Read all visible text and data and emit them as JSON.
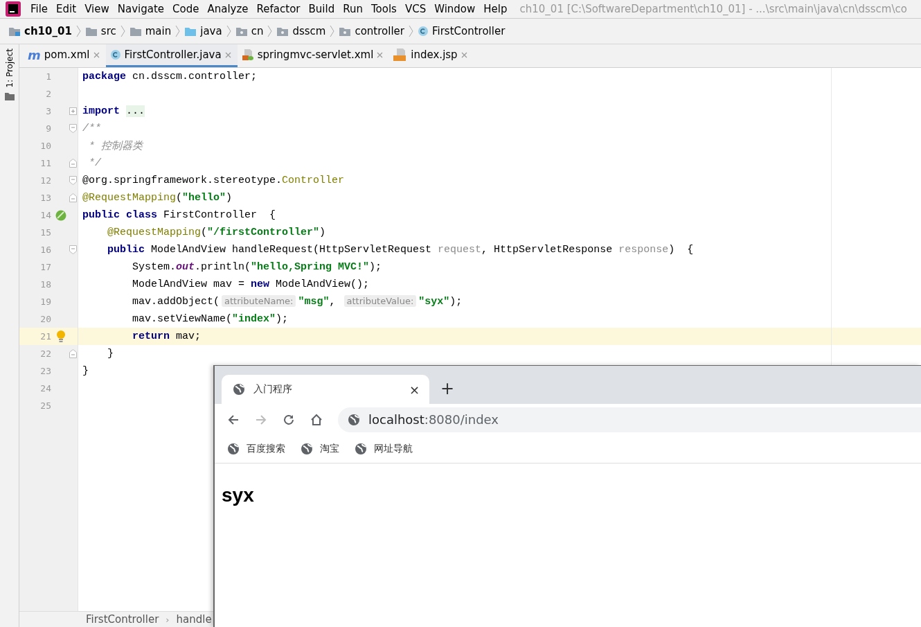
{
  "menu": {
    "items": [
      "File",
      "Edit",
      "View",
      "Navigate",
      "Code",
      "Analyze",
      "Refactor",
      "Build",
      "Run",
      "Tools",
      "VCS",
      "Window",
      "Help"
    ],
    "title": "ch10_01 [C:\\SoftwareDepartment\\ch10_01] - ...\\src\\main\\java\\cn\\dsscm\\co"
  },
  "breadcrumb": [
    {
      "label": "ch10_01",
      "kind": "module"
    },
    {
      "label": "src",
      "kind": "folder"
    },
    {
      "label": "main",
      "kind": "folder"
    },
    {
      "label": "java",
      "kind": "source"
    },
    {
      "label": "cn",
      "kind": "package"
    },
    {
      "label": "dsscm",
      "kind": "package"
    },
    {
      "label": "controller",
      "kind": "package"
    },
    {
      "label": "FirstController",
      "kind": "class"
    }
  ],
  "tool_strip": {
    "label": "1: Project"
  },
  "tabs": [
    {
      "label": "pom.xml",
      "kind": "maven",
      "icon_text": "m",
      "selected": false
    },
    {
      "label": "FirstController.java",
      "kind": "class",
      "selected": true
    },
    {
      "label": "springmvc-servlet.xml",
      "kind": "xml",
      "selected": false
    },
    {
      "label": "index.jsp",
      "kind": "jsp",
      "selected": false
    }
  ],
  "code": [
    {
      "number": "1",
      "tokens": [
        {
          "t": "package",
          "kind": "kw"
        },
        {
          "t": " cn.dsscm.controller;",
          "kind": "plain"
        }
      ]
    },
    {
      "number": "2"
    },
    {
      "number": "3",
      "fold": {
        "kind": "plus"
      },
      "tokens": [
        {
          "t": "import ",
          "kind": "kw"
        },
        {
          "t": "...",
          "kind": "folded"
        }
      ]
    },
    {
      "number": "9",
      "fold": {
        "kind": "start"
      },
      "tokens": [
        {
          "t": "/**",
          "kind": "comment"
        }
      ]
    },
    {
      "number": "10",
      "tokens": [
        {
          "t": " * 控制器类",
          "kind": "comment"
        }
      ]
    },
    {
      "number": "11",
      "fold": {
        "kind": "end"
      },
      "tokens": [
        {
          "t": " */",
          "kind": "comment"
        }
      ]
    },
    {
      "number": "12",
      "fold": {
        "kind": "start"
      },
      "tokens": [
        {
          "t": "@org.springframework.stereotype.",
          "kind": "plain"
        },
        {
          "t": "Controller",
          "kind": "ann"
        }
      ]
    },
    {
      "number": "13",
      "fold": {
        "kind": "end"
      },
      "tokens": [
        {
          "t": "@RequestMapping",
          "kind": "ann"
        },
        {
          "t": "(",
          "kind": "plain"
        },
        {
          "t": "\"hello\"",
          "kind": "str"
        },
        {
          "t": ")",
          "kind": "plain"
        }
      ]
    },
    {
      "number": "14",
      "marker": {
        "kind": "bean"
      },
      "tokens": [
        {
          "t": "public class",
          "kind": "kw"
        },
        {
          "t": " FirstController  {",
          "kind": "plain"
        }
      ]
    },
    {
      "number": "15",
      "tokens": [
        {
          "t": "    @RequestMapping",
          "kind": "ann"
        },
        {
          "t": "(",
          "kind": "plain"
        },
        {
          "t": "\"/firstController\"",
          "kind": "str"
        },
        {
          "t": ")",
          "kind": "plain"
        }
      ]
    },
    {
      "number": "16",
      "fold": {
        "kind": "start"
      },
      "tokens": [
        {
          "t": "    public",
          "kind": "kw"
        },
        {
          "t": " ModelAndView handleRequest(HttpServletRequest ",
          "kind": "plain"
        },
        {
          "t": "request",
          "kind": "param"
        },
        {
          "t": ", HttpServletResponse ",
          "kind": "plain"
        },
        {
          "t": "response",
          "kind": "param"
        },
        {
          "t": ")  {",
          "kind": "plain"
        }
      ]
    },
    {
      "number": "17",
      "tokens": [
        {
          "t": "        System.",
          "kind": "plain"
        },
        {
          "t": "out",
          "kind": "field"
        },
        {
          "t": ".println(",
          "kind": "plain"
        },
        {
          "t": "\"hello,Spring MVC!\"",
          "kind": "str"
        },
        {
          "t": ");",
          "kind": "plain"
        }
      ]
    },
    {
      "number": "18",
      "tokens": [
        {
          "t": "        ModelAndView mav = ",
          "kind": "plain"
        },
        {
          "t": "new",
          "kind": "kw"
        },
        {
          "t": " ModelAndView();",
          "kind": "plain"
        }
      ]
    },
    {
      "number": "19",
      "tokens": [
        {
          "t": "        mav.addObject(",
          "kind": "plain"
        },
        {
          "t": "attributeName:",
          "kind": "hint"
        },
        {
          "t": "\"msg\"",
          "kind": "str"
        },
        {
          "t": ", ",
          "kind": "plain"
        },
        {
          "t": "attributeValue:",
          "kind": "hint"
        },
        {
          "t": "\"syx\"",
          "kind": "str"
        },
        {
          "t": ");",
          "kind": "plain"
        }
      ]
    },
    {
      "number": "20",
      "tokens": [
        {
          "t": "        mav.setViewName(",
          "kind": "plain"
        },
        {
          "t": "\"index\"",
          "kind": "str"
        },
        {
          "t": ");",
          "kind": "plain"
        }
      ]
    },
    {
      "number": "21",
      "marker": {
        "kind": "bulb"
      },
      "current": true,
      "tokens": [
        {
          "t": "        return",
          "kind": "kw"
        },
        {
          "t": " mav;",
          "kind": "plain"
        }
      ]
    },
    {
      "number": "22",
      "fold": {
        "kind": "end"
      },
      "tokens": [
        {
          "t": "    }",
          "kind": "plain"
        }
      ]
    },
    {
      "number": "23",
      "tokens": [
        {
          "t": "}",
          "kind": "plain"
        }
      ]
    },
    {
      "number": "24"
    },
    {
      "number": "25"
    }
  ],
  "status_breadcrumb": [
    "FirstController",
    "›",
    "handle"
  ],
  "browser": {
    "tab": {
      "title": "入门程序",
      "close": "×"
    },
    "new_tab": "+",
    "nav": [
      {
        "kind": "back",
        "disabled": false
      },
      {
        "kind": "forward",
        "disabled": true
      },
      {
        "kind": "reload",
        "disabled": false
      },
      {
        "kind": "home",
        "disabled": false
      }
    ],
    "address": {
      "host": "localhost",
      "path": ":8080/index"
    },
    "bookmarks": [
      "百度搜索",
      "淘宝",
      "网址导航"
    ],
    "content": "syx"
  }
}
